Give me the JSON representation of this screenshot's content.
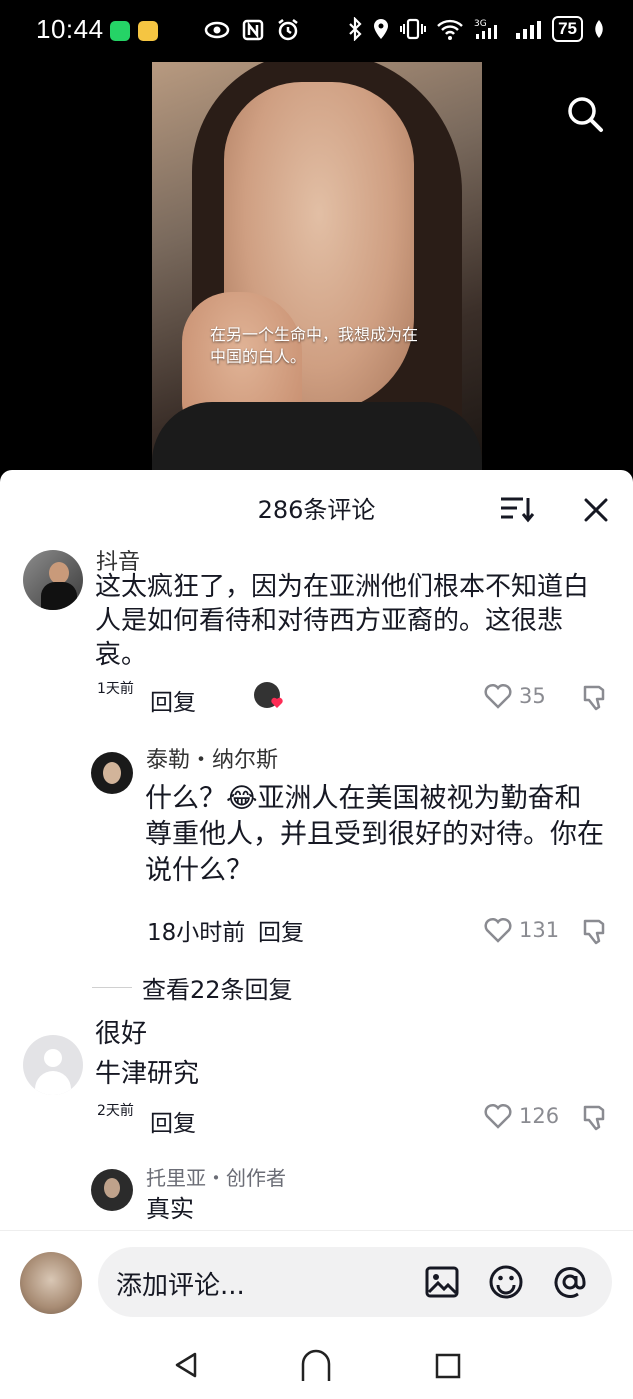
{
  "status_bar": {
    "time": "10:44",
    "battery": "75",
    "icons": [
      "whatsapp-icon",
      "app-icon",
      "eye-icon",
      "nfc-icon",
      "alarm-icon",
      "bluetooth-icon",
      "location-icon",
      "vibrate-icon",
      "wifi-icon",
      "signal-3g-icon",
      "signal-icon",
      "leaf-icon"
    ]
  },
  "video": {
    "subtitle": "在另一个生命中，我想成为在中国的白人。"
  },
  "comments_panel": {
    "title": "286条评论",
    "comments": [
      {
        "username": "抖音",
        "text": "这太疯狂了，因为在亚洲他们根本不知道白人是如何看待和对待西方亚裔的。这很悲哀。",
        "time": "1天前",
        "reply_label": "回复",
        "likes": "35"
      },
      {
        "username": "泰勒・纳尔斯",
        "text": "什么？😂亚洲人在美国被视为勤奋和尊重他人，并且受到很好的对待。你在说什么？",
        "time": "18小时前",
        "reply_label": "回复",
        "likes": "131"
      },
      {
        "username": "很好",
        "text": "牛津研究",
        "time": "2天前",
        "reply_label": "回复",
        "likes": "126"
      },
      {
        "username": "托里亚",
        "creator_tag": "・创作者",
        "text": "真实"
      }
    ],
    "view_replies": "查看22条回复"
  },
  "input_bar": {
    "placeholder": "添加评论..."
  },
  "colors": {
    "sheet_bg": "#ffffff",
    "text_primary": "#161823",
    "text_secondary": "#8a8b91",
    "like_badge": "#fe2c55",
    "input_bg": "#f1f1f2"
  }
}
